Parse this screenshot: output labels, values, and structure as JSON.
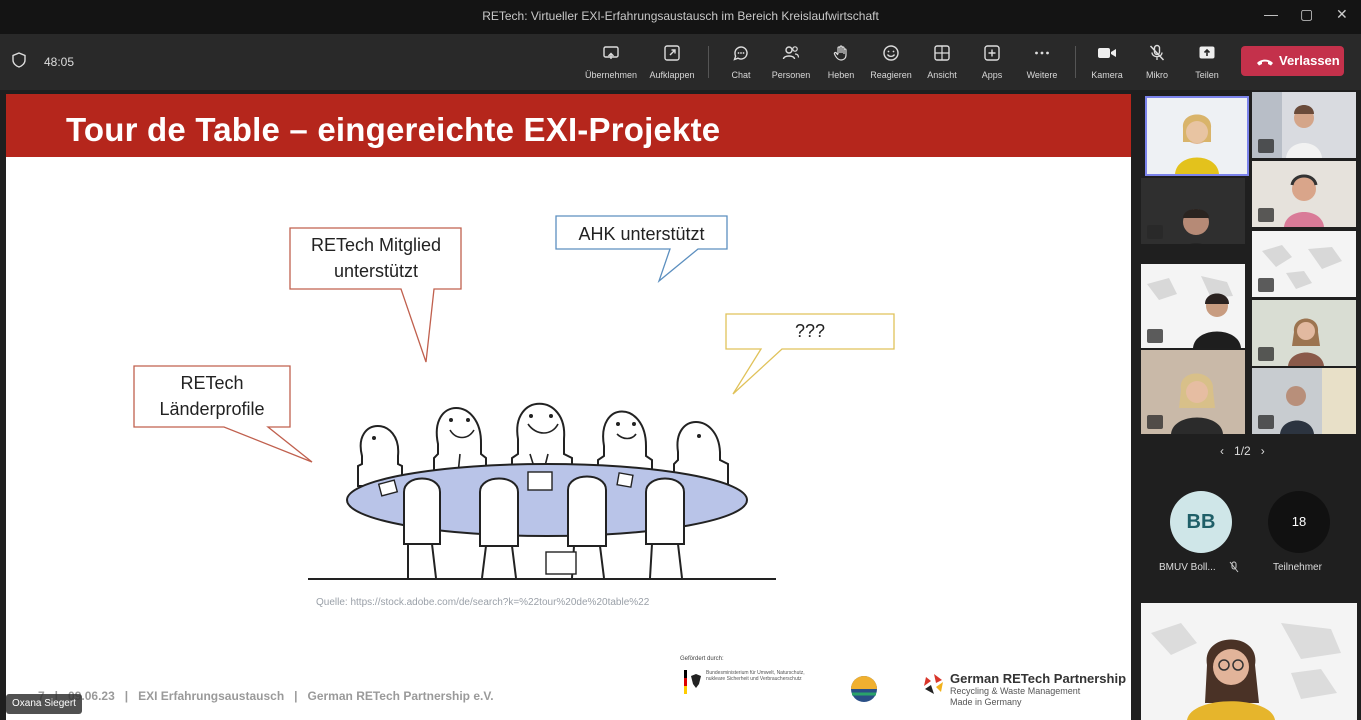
{
  "window": {
    "title": "RETech: Virtueller EXI-Erfahrungsaustausch im Bereich Kreislaufwirtschaft",
    "min_glyph": "—",
    "max_glyph": "▢",
    "close_glyph": "✕"
  },
  "meeting": {
    "timer": "48:05"
  },
  "toolbar": {
    "share": "Übernehmen",
    "popout": "Aufklappen",
    "chat": "Chat",
    "people": "Personen",
    "raise_hand": "Heben",
    "react": "Reagieren",
    "view": "Ansicht",
    "apps": "Apps",
    "more": "Weitere",
    "camera": "Kamera",
    "mic": "Mikro",
    "share_screen": "Teilen",
    "leave": "Verlassen"
  },
  "slide": {
    "title": "Tour de Table – eingereichte EXI-Projekte",
    "bubble_1": "RETech Mitglied unterstützt",
    "bubble_2": "AHK unterstützt",
    "bubble_3": "???",
    "bubble_4": "RETech Länderprofile",
    "source": "Quelle: https://stock.adobe.com/de/search?k=%22tour%20de%20table%22",
    "footer": "7   |   09.06.23   |   EXI Erfahrungsaustausch   |   German RETech Partnership e.V.",
    "funder_label": "Gefördert durch:",
    "funder_text": "Bundesministerium für Umwelt, Naturschutz, nukleare Sicherheit und Verbraucherschutz",
    "partner_name": "German RETech Partnership",
    "partner_line1": "Recycling & Waste Management",
    "partner_line2": "Made in Germany"
  },
  "presenter_name": "Oxana Siegert",
  "gallery": {
    "pager": "1/2",
    "participant_initials": "BB",
    "participant_label": "BMUV Boll...",
    "count": "18",
    "count_label": "Teilnehmer"
  },
  "colors": {
    "slide_header": "#b5261c",
    "leave_button": "#c4314b",
    "bubble_red": "#c0604e",
    "bubble_blue": "#5c8fbf",
    "bubble_yellow": "#e0c25a",
    "table": "#b9c4e8"
  },
  "icons": [
    "shield-icon",
    "share-icon",
    "popout-icon",
    "chat-icon",
    "people-icon",
    "hand-icon",
    "react-icon",
    "view-icon",
    "apps-icon",
    "more-icon",
    "camera-icon",
    "mic-off-icon",
    "share-screen-icon",
    "phone-icon"
  ]
}
